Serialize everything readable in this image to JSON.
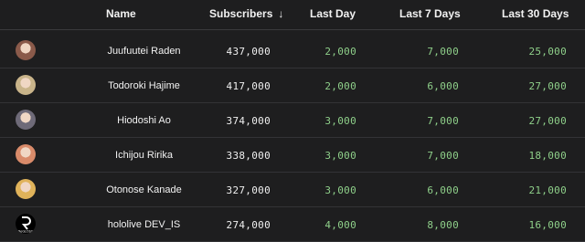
{
  "headers": {
    "name": "Name",
    "subscribers": "Subscribers",
    "sort_icon": "↓",
    "last_day": "Last Day",
    "last_7_days": "Last 7 Days",
    "last_30_days": "Last 30 Days"
  },
  "rows": [
    {
      "name": "Juufuutei Raden",
      "subscribers": "437,000",
      "last_day": "2,000",
      "last_7_days": "7,000",
      "last_30_days": "25,000",
      "avatar_icon": "raden-avatar-icon",
      "avatar_color": "#8a5a4a"
    },
    {
      "name": "Todoroki Hajime",
      "subscribers": "417,000",
      "last_day": "2,000",
      "last_7_days": "6,000",
      "last_30_days": "27,000",
      "avatar_icon": "hajime-avatar-icon",
      "avatar_color": "#c9b48a"
    },
    {
      "name": "Hiodoshi Ao",
      "subscribers": "374,000",
      "last_day": "3,000",
      "last_7_days": "7,000",
      "last_30_days": "27,000",
      "avatar_icon": "ao-avatar-icon",
      "avatar_color": "#6e6a78"
    },
    {
      "name": "Ichijou Ririka",
      "subscribers": "338,000",
      "last_day": "3,000",
      "last_7_days": "7,000",
      "last_30_days": "18,000",
      "avatar_icon": "ririka-avatar-icon",
      "avatar_color": "#d98b6a"
    },
    {
      "name": "Otonose Kanade",
      "subscribers": "327,000",
      "last_day": "3,000",
      "last_7_days": "6,000",
      "last_30_days": "21,000",
      "avatar_icon": "kanade-avatar-icon",
      "avatar_color": "#e0b35a"
    },
    {
      "name": "hololive DEV_IS",
      "subscribers": "274,000",
      "last_day": "4,000",
      "last_7_days": "8,000",
      "last_30_days": "16,000",
      "avatar_icon": "devis-logo-icon",
      "avatar_color": "#000000",
      "avatar_text": "ReGLOSS"
    }
  ]
}
